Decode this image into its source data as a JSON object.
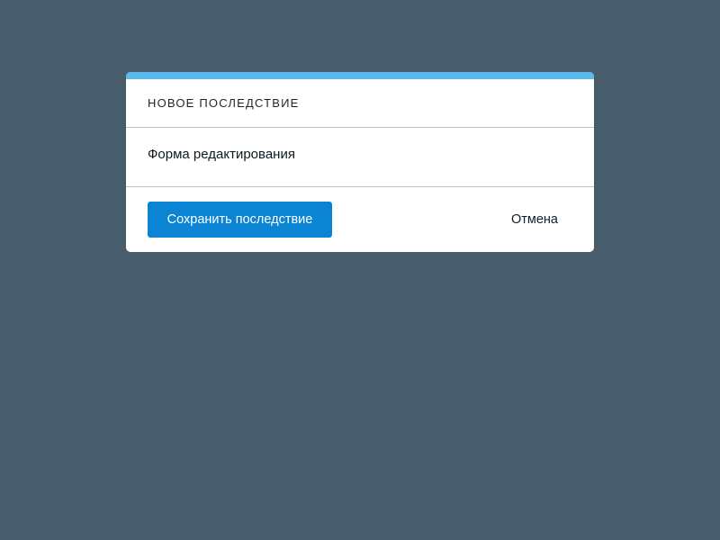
{
  "modal": {
    "title": "НОВОЕ ПОСЛЕДСТВИЕ",
    "body_text": "Форма редактирования",
    "save_label": "Сохранить последствие",
    "cancel_label": "Отмена"
  },
  "colors": {
    "backdrop": "#485d6b",
    "accent": "#5bb8ec",
    "primary_button": "#0a84d3"
  }
}
